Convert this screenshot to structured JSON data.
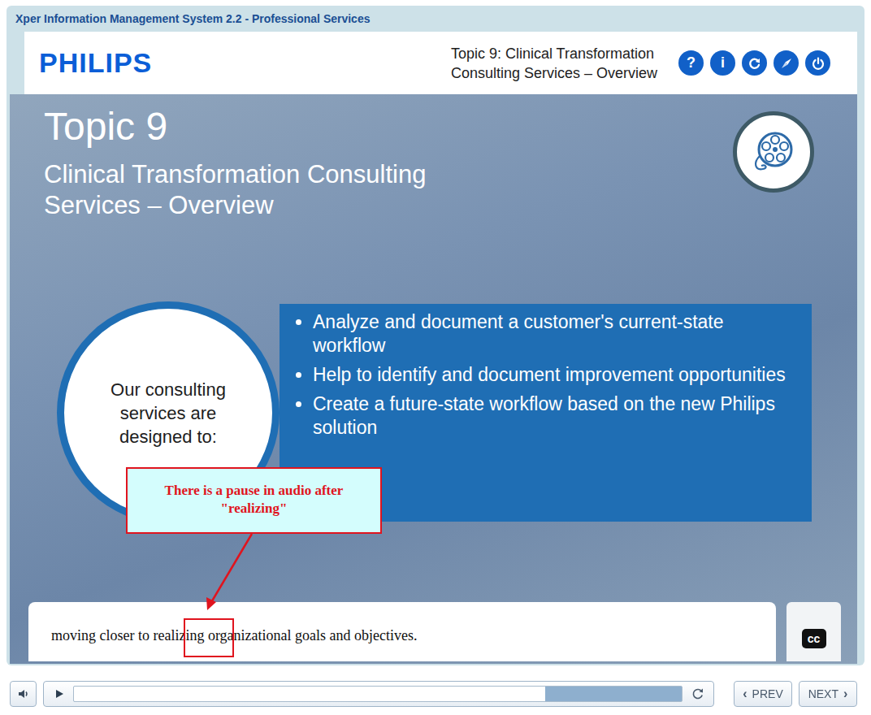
{
  "window": {
    "title": "Xper Information Management System 2.2 - Professional Services"
  },
  "header": {
    "logo": "PHILIPS",
    "topic_lines": [
      "Topic 9: Clinical Transformation",
      "Consulting Services – Overview"
    ],
    "nav_buttons": [
      {
        "kind": "help",
        "glyph": "?"
      },
      {
        "kind": "info",
        "glyph": "i"
      },
      {
        "kind": "replay",
        "glyph": ""
      },
      {
        "kind": "map",
        "glyph": ""
      },
      {
        "kind": "exit",
        "glyph": ""
      }
    ]
  },
  "slide": {
    "title": "Topic 9",
    "subtitle_lines": [
      "Clinical Transformation Consulting",
      "Services – Overview"
    ],
    "circle_text": "Our consulting services are designed to:",
    "bullets": [
      "Analyze and document a customer's current-state workflow",
      "Help to identify and document improvement opportunities",
      "Create a future-state workflow based on the new Philips solution"
    ],
    "annotation": "There is a pause in audio after \"realizing\"",
    "caption": "moving closer to realizing organizational goals and objectives.",
    "cc_label": "cc"
  },
  "controls": {
    "progress": {
      "level": 0.775
    },
    "prev": {
      "glyph": "‹",
      "label": "PREV"
    },
    "next": {
      "label": "NEXT",
      "glyph": "›"
    }
  }
}
